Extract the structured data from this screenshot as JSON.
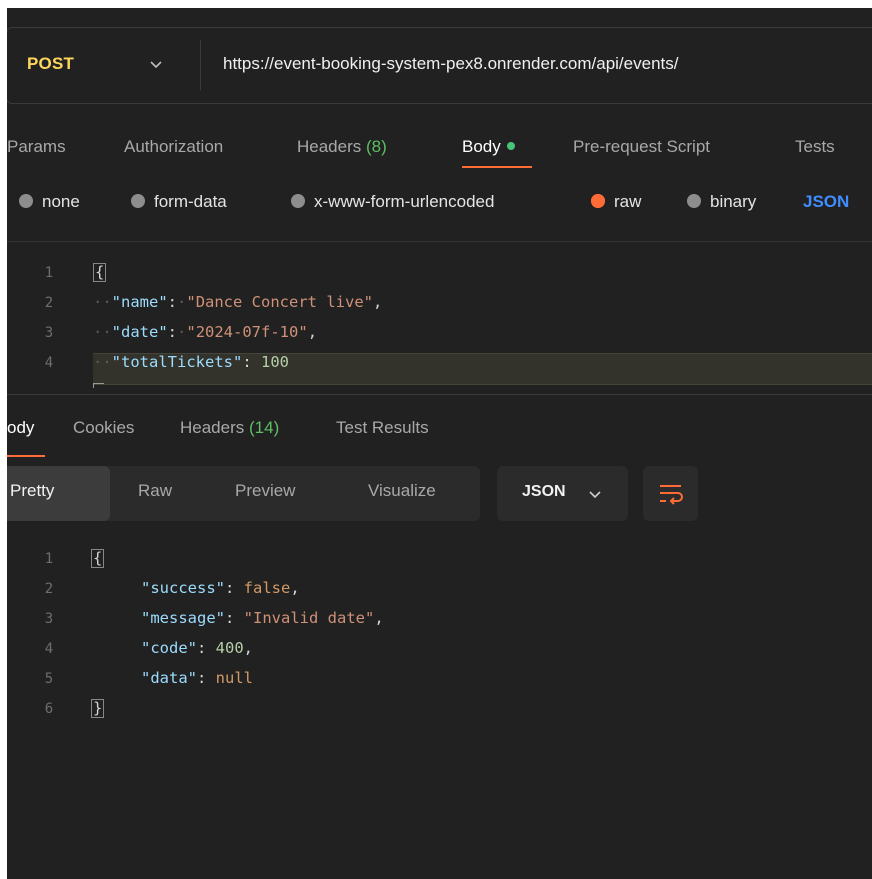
{
  "request": {
    "method": "POST",
    "url": "https://event-booking-system-pex8.onrender.com/api/events/"
  },
  "request_tabs": {
    "params": "Params",
    "authorization": "Authorization",
    "headers_label": "Headers",
    "headers_count": "(8)",
    "body": "Body",
    "prerequest": "Pre-request Script",
    "tests": "Tests"
  },
  "body_types": {
    "none": "none",
    "form_data": "form-data",
    "urlencoded": "x-www-form-urlencoded",
    "raw": "raw",
    "binary": "binary",
    "json": "JSON"
  },
  "request_body": {
    "line_numbers": [
      "1",
      "2",
      "3",
      "4"
    ],
    "open_brace": "{",
    "name_key": "\"name\"",
    "name_value": "\"Dance Concert live\"",
    "date_key": "\"date\"",
    "date_value": "\"2024-07f-10\"",
    "tickets_key": "\"totalTickets\"",
    "tickets_value": "100"
  },
  "response_tabs": {
    "body": "ody",
    "cookies": "Cookies",
    "headers_label": "Headers",
    "headers_count": "(14)",
    "test_results": "Test Results"
  },
  "view_modes": {
    "pretty": "Pretty",
    "raw": "Raw",
    "preview": "Preview",
    "visualize": "Visualize",
    "format": "JSON"
  },
  "response_body": {
    "line_numbers": [
      "1",
      "2",
      "3",
      "4",
      "5",
      "6"
    ],
    "open_brace": "{",
    "close_brace": "}",
    "success_key": "\"success\"",
    "success_value": "false",
    "message_key": "\"message\"",
    "message_value": "\"Invalid date\"",
    "code_key": "\"code\"",
    "code_value": "400",
    "data_key": "\"data\"",
    "data_value": "null"
  },
  "colors": {
    "background": "#212121",
    "accent_orange": "#ff6c37",
    "method_yellow": "#ffd65c",
    "json_blue": "#3f8dff",
    "count_green": "#5dbf63"
  },
  "icons": [
    "chevron-down-icon",
    "word-wrap-icon"
  ]
}
